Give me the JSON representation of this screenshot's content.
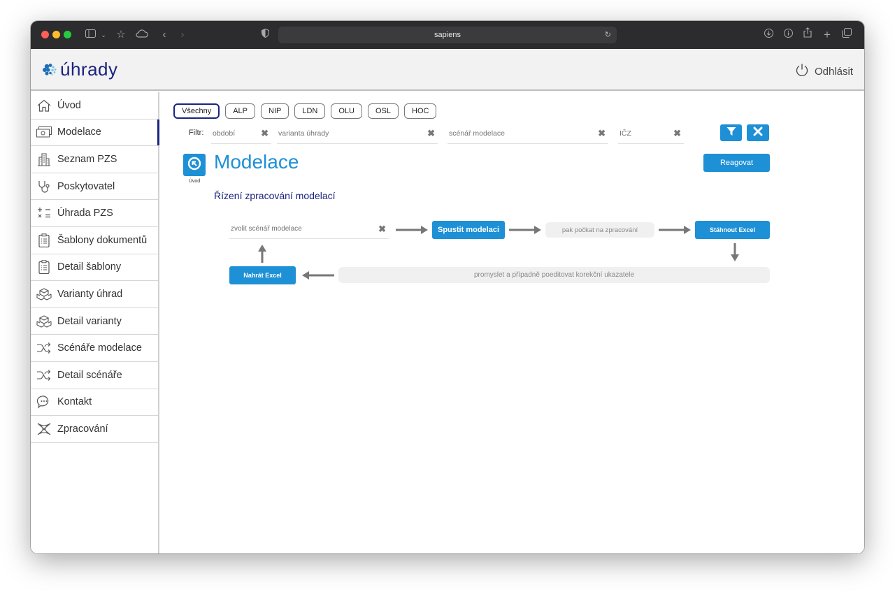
{
  "browser": {
    "url": "sapiens"
  },
  "app": {
    "logo_text": "úhrady",
    "logout_label": "Odhlásit"
  },
  "sidebar": {
    "items": [
      {
        "label": "Úvod",
        "icon": "home-icon"
      },
      {
        "label": "Modelace",
        "icon": "money-icon",
        "active": true
      },
      {
        "label": "Seznam PZS",
        "icon": "building-icon"
      },
      {
        "label": "Poskytovatel",
        "icon": "stethoscope-icon"
      },
      {
        "label": "Úhrada PZS",
        "icon": "calculator-icon"
      },
      {
        "label": "Šablony dokumentů",
        "icon": "clipboard-icon"
      },
      {
        "label": "Detail šablony",
        "icon": "clipboard-icon"
      },
      {
        "label": "Varianty úhrad",
        "icon": "boxes-icon"
      },
      {
        "label": "Detail varianty",
        "icon": "boxes-icon"
      },
      {
        "label": "Scénáře modelace",
        "icon": "shuffle-icon"
      },
      {
        "label": "Detail scénáře",
        "icon": "shuffle-icon"
      },
      {
        "label": "Kontakt",
        "icon": "chat-icon"
      },
      {
        "label": "Zpracování",
        "icon": "dna-icon"
      }
    ]
  },
  "tabs": [
    "Všechny",
    "ALP",
    "NIP",
    "LDN",
    "OLU",
    "OSL",
    "HOC"
  ],
  "filter": {
    "label": "Filtr:",
    "fields": [
      {
        "placeholder": "období"
      },
      {
        "placeholder": "varianta úhrady"
      },
      {
        "placeholder": "scénář modelace"
      },
      {
        "placeholder": "IČZ"
      }
    ]
  },
  "page": {
    "home_label": "Úvod",
    "title": "Modelace",
    "reagovat_label": "Reagovat",
    "subtitle": "Řízení zpracování modelací"
  },
  "workflow": {
    "scenario_placeholder": "zvolit scénář modelace",
    "run_label": "Spustit modelaci",
    "wait_text": "pak počkat na zpracování",
    "download_label": "Stáhnout Excel",
    "review_text": "promyslet a případně poeditovat korekční ukazatele",
    "upload_label": "Nahrát Excel"
  },
  "colors": {
    "accent": "#1e90d6",
    "navy": "#1a237e"
  }
}
